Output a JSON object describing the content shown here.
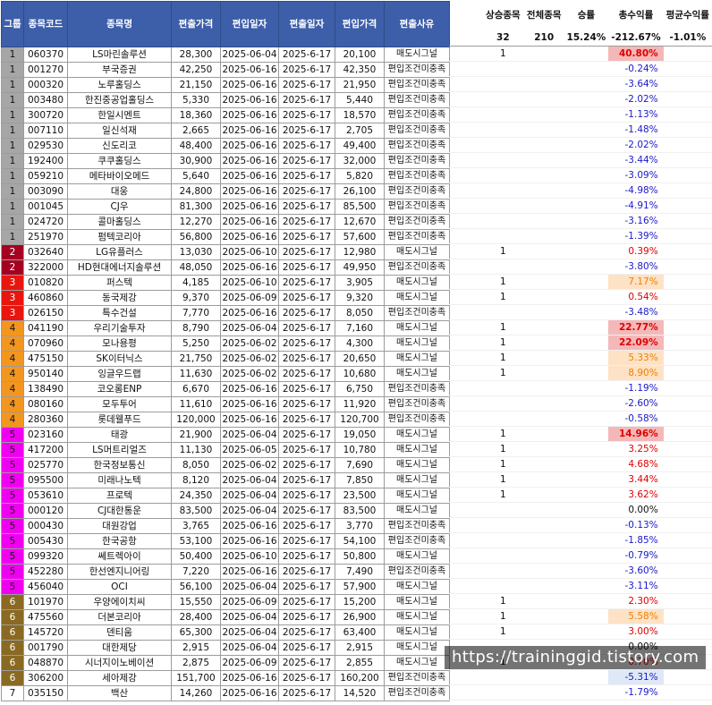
{
  "headers": {
    "group": "그룹",
    "code": "종목코드",
    "name": "종목명",
    "exit_price": "편출가격",
    "entry_date": "편입일자",
    "exit_date": "편출일자",
    "entry_price": "편입가격",
    "reason": "편출사유"
  },
  "summary": {
    "labels": [
      "상승종목",
      "전체종목",
      "승률",
      "총수익률",
      "평균수익률"
    ],
    "values": [
      "32",
      "210",
      "15.24%",
      "-212.67%",
      "-1.01%"
    ]
  },
  "colors": {
    "group1": "#a6a6a6",
    "group2": "#a50021",
    "group3": "#e8160f",
    "group4": "#f29620",
    "group5": "#f000f0",
    "group6": "#8a6a22",
    "group7": "#ffffff",
    "header_bg": "#3d5ea8",
    "positive": "#e00000",
    "negative": "#1a1acc"
  },
  "rows": [
    {
      "g": "1",
      "code": "060370",
      "name": "LS마린솔루션",
      "exit_price": "28,300",
      "entry_date": "2025-06-04",
      "exit_date": "2025-6-17",
      "entry_price": "20,100",
      "reason": "매도시그널",
      "up": "1",
      "ret": "40.80%",
      "hl": "hl1"
    },
    {
      "g": "1",
      "code": "001270",
      "name": "부국증권",
      "exit_price": "42,250",
      "entry_date": "2025-06-16",
      "exit_date": "2025-6-17",
      "entry_price": "42,350",
      "reason": "편입조건미충족",
      "up": "",
      "ret": "-0.24%",
      "hl": ""
    },
    {
      "g": "1",
      "code": "000320",
      "name": "노루홀딩스",
      "exit_price": "21,150",
      "entry_date": "2025-06-16",
      "exit_date": "2025-6-17",
      "entry_price": "21,950",
      "reason": "편입조건미충족",
      "up": "",
      "ret": "-3.64%",
      "hl": ""
    },
    {
      "g": "1",
      "code": "003480",
      "name": "한진중공업홀딩스",
      "exit_price": "5,330",
      "entry_date": "2025-06-16",
      "exit_date": "2025-6-17",
      "entry_price": "5,440",
      "reason": "편입조건미충족",
      "up": "",
      "ret": "-2.02%",
      "hl": ""
    },
    {
      "g": "1",
      "code": "300720",
      "name": "한일시멘트",
      "exit_price": "18,360",
      "entry_date": "2025-06-16",
      "exit_date": "2025-6-17",
      "entry_price": "18,570",
      "reason": "편입조건미충족",
      "up": "",
      "ret": "-1.13%",
      "hl": ""
    },
    {
      "g": "1",
      "code": "007110",
      "name": "일신석재",
      "exit_price": "2,665",
      "entry_date": "2025-06-16",
      "exit_date": "2025-6-17",
      "entry_price": "2,705",
      "reason": "편입조건미충족",
      "up": "",
      "ret": "-1.48%",
      "hl": ""
    },
    {
      "g": "1",
      "code": "029530",
      "name": "신도리코",
      "exit_price": "48,400",
      "entry_date": "2025-06-16",
      "exit_date": "2025-6-17",
      "entry_price": "49,400",
      "reason": "편입조건미충족",
      "up": "",
      "ret": "-2.02%",
      "hl": ""
    },
    {
      "g": "1",
      "code": "192400",
      "name": "쿠쿠홀딩스",
      "exit_price": "30,900",
      "entry_date": "2025-06-16",
      "exit_date": "2025-6-17",
      "entry_price": "32,000",
      "reason": "편입조건미충족",
      "up": "",
      "ret": "-3.44%",
      "hl": ""
    },
    {
      "g": "1",
      "code": "059210",
      "name": "메타바이오메드",
      "exit_price": "5,640",
      "entry_date": "2025-06-16",
      "exit_date": "2025-6-17",
      "entry_price": "5,820",
      "reason": "편입조건미충족",
      "up": "",
      "ret": "-3.09%",
      "hl": ""
    },
    {
      "g": "1",
      "code": "003090",
      "name": "대웅",
      "exit_price": "24,800",
      "entry_date": "2025-06-16",
      "exit_date": "2025-6-17",
      "entry_price": "26,100",
      "reason": "편입조건미충족",
      "up": "",
      "ret": "-4.98%",
      "hl": ""
    },
    {
      "g": "1",
      "code": "001045",
      "name": "CJ우",
      "exit_price": "81,300",
      "entry_date": "2025-06-16",
      "exit_date": "2025-6-17",
      "entry_price": "85,500",
      "reason": "편입조건미충족",
      "up": "",
      "ret": "-4.91%",
      "hl": ""
    },
    {
      "g": "1",
      "code": "024720",
      "name": "콜마홀딩스",
      "exit_price": "12,270",
      "entry_date": "2025-06-16",
      "exit_date": "2025-6-17",
      "entry_price": "12,670",
      "reason": "편입조건미충족",
      "up": "",
      "ret": "-3.16%",
      "hl": ""
    },
    {
      "g": "1",
      "code": "251970",
      "name": "펌텍코리아",
      "exit_price": "56,800",
      "entry_date": "2025-06-16",
      "exit_date": "2025-6-17",
      "entry_price": "57,600",
      "reason": "편입조건미충족",
      "up": "",
      "ret": "-1.39%",
      "hl": ""
    },
    {
      "g": "2",
      "code": "032640",
      "name": "LG유플러스",
      "exit_price": "13,030",
      "entry_date": "2025-06-10",
      "exit_date": "2025-6-17",
      "entry_price": "12,980",
      "reason": "매도시그널",
      "up": "1",
      "ret": "0.39%",
      "hl": ""
    },
    {
      "g": "2",
      "code": "322000",
      "name": "HD현대에너지솔루션",
      "exit_price": "48,050",
      "entry_date": "2025-06-16",
      "exit_date": "2025-6-17",
      "entry_price": "49,950",
      "reason": "편입조건미충족",
      "up": "",
      "ret": "-3.80%",
      "hl": ""
    },
    {
      "g": "3",
      "code": "010820",
      "name": "퍼스텍",
      "exit_price": "4,185",
      "entry_date": "2025-06-10",
      "exit_date": "2025-6-17",
      "entry_price": "3,905",
      "reason": "매도시그널",
      "up": "1",
      "ret": "7.17%",
      "hl": "hl2"
    },
    {
      "g": "3",
      "code": "460860",
      "name": "동국제강",
      "exit_price": "9,370",
      "entry_date": "2025-06-09",
      "exit_date": "2025-6-17",
      "entry_price": "9,320",
      "reason": "매도시그널",
      "up": "1",
      "ret": "0.54%",
      "hl": ""
    },
    {
      "g": "3",
      "code": "026150",
      "name": "특수건설",
      "exit_price": "7,770",
      "entry_date": "2025-06-16",
      "exit_date": "2025-6-17",
      "entry_price": "8,050",
      "reason": "편입조건미충족",
      "up": "",
      "ret": "-3.48%",
      "hl": ""
    },
    {
      "g": "4",
      "code": "041190",
      "name": "우리기술투자",
      "exit_price": "8,790",
      "entry_date": "2025-06-04",
      "exit_date": "2025-6-17",
      "entry_price": "7,160",
      "reason": "매도시그널",
      "up": "1",
      "ret": "22.77%",
      "hl": "hl1"
    },
    {
      "g": "4",
      "code": "070960",
      "name": "모나용평",
      "exit_price": "5,250",
      "entry_date": "2025-06-02",
      "exit_date": "2025-6-17",
      "entry_price": "4,300",
      "reason": "매도시그널",
      "up": "1",
      "ret": "22.09%",
      "hl": "hl1"
    },
    {
      "g": "4",
      "code": "475150",
      "name": "SK이터닉스",
      "exit_price": "21,750",
      "entry_date": "2025-06-02",
      "exit_date": "2025-6-17",
      "entry_price": "20,650",
      "reason": "매도시그널",
      "up": "1",
      "ret": "5.33%",
      "hl": "hl2"
    },
    {
      "g": "4",
      "code": "950140",
      "name": "잉글우드랩",
      "exit_price": "11,630",
      "entry_date": "2025-06-02",
      "exit_date": "2025-6-17",
      "entry_price": "10,680",
      "reason": "매도시그널",
      "up": "1",
      "ret": "8.90%",
      "hl": "hl2"
    },
    {
      "g": "4",
      "code": "138490",
      "name": "코오롱ENP",
      "exit_price": "6,670",
      "entry_date": "2025-06-16",
      "exit_date": "2025-6-17",
      "entry_price": "6,750",
      "reason": "편입조건미충족",
      "up": "",
      "ret": "-1.19%",
      "hl": ""
    },
    {
      "g": "4",
      "code": "080160",
      "name": "모두투어",
      "exit_price": "11,610",
      "entry_date": "2025-06-16",
      "exit_date": "2025-6-17",
      "entry_price": "11,920",
      "reason": "편입조건미충족",
      "up": "",
      "ret": "-2.60%",
      "hl": ""
    },
    {
      "g": "4",
      "code": "280360",
      "name": "롯데웰푸드",
      "exit_price": "120,000",
      "entry_date": "2025-06-16",
      "exit_date": "2025-6-17",
      "entry_price": "120,700",
      "reason": "편입조건미충족",
      "up": "",
      "ret": "-0.58%",
      "hl": ""
    },
    {
      "g": "5",
      "code": "023160",
      "name": "태광",
      "exit_price": "21,900",
      "entry_date": "2025-06-04",
      "exit_date": "2025-6-17",
      "entry_price": "19,050",
      "reason": "매도시그널",
      "up": "1",
      "ret": "14.96%",
      "hl": "hl1"
    },
    {
      "g": "5",
      "code": "417200",
      "name": "LS머트리얼즈",
      "exit_price": "11,130",
      "entry_date": "2025-06-05",
      "exit_date": "2025-6-17",
      "entry_price": "10,780",
      "reason": "매도시그널",
      "up": "1",
      "ret": "3.25%",
      "hl": ""
    },
    {
      "g": "5",
      "code": "025770",
      "name": "한국정보통신",
      "exit_price": "8,050",
      "entry_date": "2025-06-02",
      "exit_date": "2025-6-17",
      "entry_price": "7,690",
      "reason": "매도시그널",
      "up": "1",
      "ret": "4.68%",
      "hl": ""
    },
    {
      "g": "5",
      "code": "095500",
      "name": "미래나노텍",
      "exit_price": "8,120",
      "entry_date": "2025-06-04",
      "exit_date": "2025-6-17",
      "entry_price": "7,850",
      "reason": "매도시그널",
      "up": "1",
      "ret": "3.44%",
      "hl": ""
    },
    {
      "g": "5",
      "code": "053610",
      "name": "프로텍",
      "exit_price": "24,350",
      "entry_date": "2025-06-04",
      "exit_date": "2025-6-17",
      "entry_price": "23,500",
      "reason": "매도시그널",
      "up": "1",
      "ret": "3.62%",
      "hl": ""
    },
    {
      "g": "5",
      "code": "000120",
      "name": "CJ대한통운",
      "exit_price": "83,500",
      "entry_date": "2025-06-04",
      "exit_date": "2025-6-17",
      "entry_price": "83,500",
      "reason": "매도시그널",
      "up": "",
      "ret": "0.00%",
      "hl": ""
    },
    {
      "g": "5",
      "code": "000430",
      "name": "대원강업",
      "exit_price": "3,765",
      "entry_date": "2025-06-16",
      "exit_date": "2025-6-17",
      "entry_price": "3,770",
      "reason": "편입조건미충족",
      "up": "",
      "ret": "-0.13%",
      "hl": ""
    },
    {
      "g": "5",
      "code": "005430",
      "name": "한국공항",
      "exit_price": "53,100",
      "entry_date": "2025-06-16",
      "exit_date": "2025-6-17",
      "entry_price": "54,100",
      "reason": "편입조건미충족",
      "up": "",
      "ret": "-1.85%",
      "hl": ""
    },
    {
      "g": "5",
      "code": "099320",
      "name": "쎄트렉아이",
      "exit_price": "50,400",
      "entry_date": "2025-06-10",
      "exit_date": "2025-6-17",
      "entry_price": "50,800",
      "reason": "매도시그널",
      "up": "",
      "ret": "-0.79%",
      "hl": ""
    },
    {
      "g": "5",
      "code": "452280",
      "name": "한선엔지니어링",
      "exit_price": "7,220",
      "entry_date": "2025-06-16",
      "exit_date": "2025-6-17",
      "entry_price": "7,490",
      "reason": "편입조건미충족",
      "up": "",
      "ret": "-3.60%",
      "hl": ""
    },
    {
      "g": "5",
      "code": "456040",
      "name": "OCI",
      "exit_price": "56,100",
      "entry_date": "2025-06-04",
      "exit_date": "2025-6-17",
      "entry_price": "57,900",
      "reason": "매도시그널",
      "up": "",
      "ret": "-3.11%",
      "hl": ""
    },
    {
      "g": "6",
      "code": "101970",
      "name": "우양에이치씨",
      "exit_price": "15,550",
      "entry_date": "2025-06-09",
      "exit_date": "2025-6-17",
      "entry_price": "15,200",
      "reason": "매도시그널",
      "up": "1",
      "ret": "2.30%",
      "hl": ""
    },
    {
      "g": "6",
      "code": "475560",
      "name": "더본코리아",
      "exit_price": "28,400",
      "entry_date": "2025-06-04",
      "exit_date": "2025-6-17",
      "entry_price": "26,900",
      "reason": "매도시그널",
      "up": "1",
      "ret": "5.58%",
      "hl": "hl2"
    },
    {
      "g": "6",
      "code": "145720",
      "name": "덴티움",
      "exit_price": "65,300",
      "entry_date": "2025-06-04",
      "exit_date": "2025-6-17",
      "entry_price": "63,400",
      "reason": "매도시그널",
      "up": "1",
      "ret": "3.00%",
      "hl": ""
    },
    {
      "g": "6",
      "code": "001790",
      "name": "대한제당",
      "exit_price": "2,915",
      "entry_date": "2025-06-04",
      "exit_date": "2025-6-17",
      "entry_price": "2,915",
      "reason": "매도시그널",
      "up": "",
      "ret": "0.00%",
      "hl": ""
    },
    {
      "g": "6",
      "code": "048870",
      "name": "시너지이노베이션",
      "exit_price": "2,875",
      "entry_date": "2025-06-09",
      "exit_date": "2025-6-17",
      "entry_price": "2,855",
      "reason": "매도시그널",
      "up": "1",
      "ret": "0.70%",
      "hl": ""
    },
    {
      "g": "6",
      "code": "306200",
      "name": "세아제강",
      "exit_price": "151,700",
      "entry_date": "2025-06-16",
      "exit_date": "2025-6-17",
      "entry_price": "160,200",
      "reason": "편입조건미충족",
      "up": "",
      "ret": "-5.31%",
      "hl": "hl3"
    },
    {
      "g": "7",
      "code": "035150",
      "name": "백산",
      "exit_price": "14,260",
      "entry_date": "2025-06-16",
      "exit_date": "2025-6-17",
      "entry_price": "14,520",
      "reason": "편입조건미충족",
      "up": "",
      "ret": "-1.79%",
      "hl": ""
    }
  ],
  "watermark": "https://traininggid.tistory.com"
}
